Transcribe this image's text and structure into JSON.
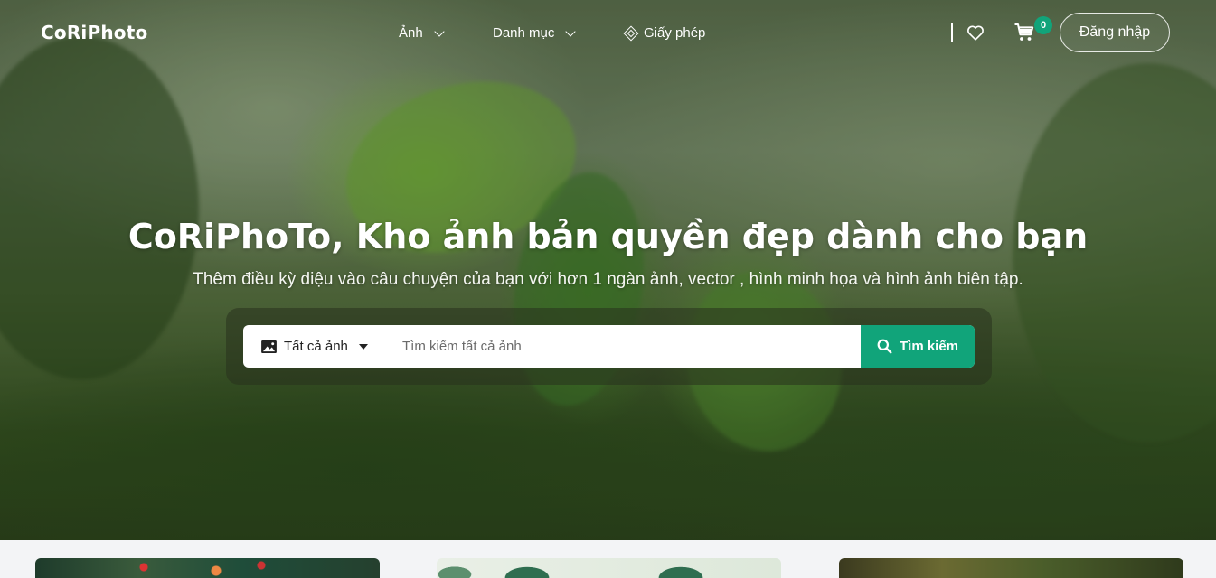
{
  "brand": {
    "logo": "CoRiPhoto",
    "accent": "#11a47a"
  },
  "nav": {
    "items": [
      {
        "label": "Ảnh"
      },
      {
        "label": "Danh mục"
      },
      {
        "label": "Giấy phép"
      }
    ]
  },
  "header_actions": {
    "cart_count": "0",
    "login_label": "Đăng nhập"
  },
  "hero": {
    "title": "CoRiPhoTo, Kho ảnh bản quyền đẹp dành cho bạn",
    "subtitle": "Thêm điều kỳ diệu vào câu chuyện của bạn với hơn 1 ngàn ảnh, vector , hình minh họa và hình ảnh biên tập."
  },
  "search": {
    "category_label": "Tất cả ảnh",
    "placeholder": "Tìm kiếm tất cả ảnh",
    "button_label": "Tìm kiếm"
  }
}
